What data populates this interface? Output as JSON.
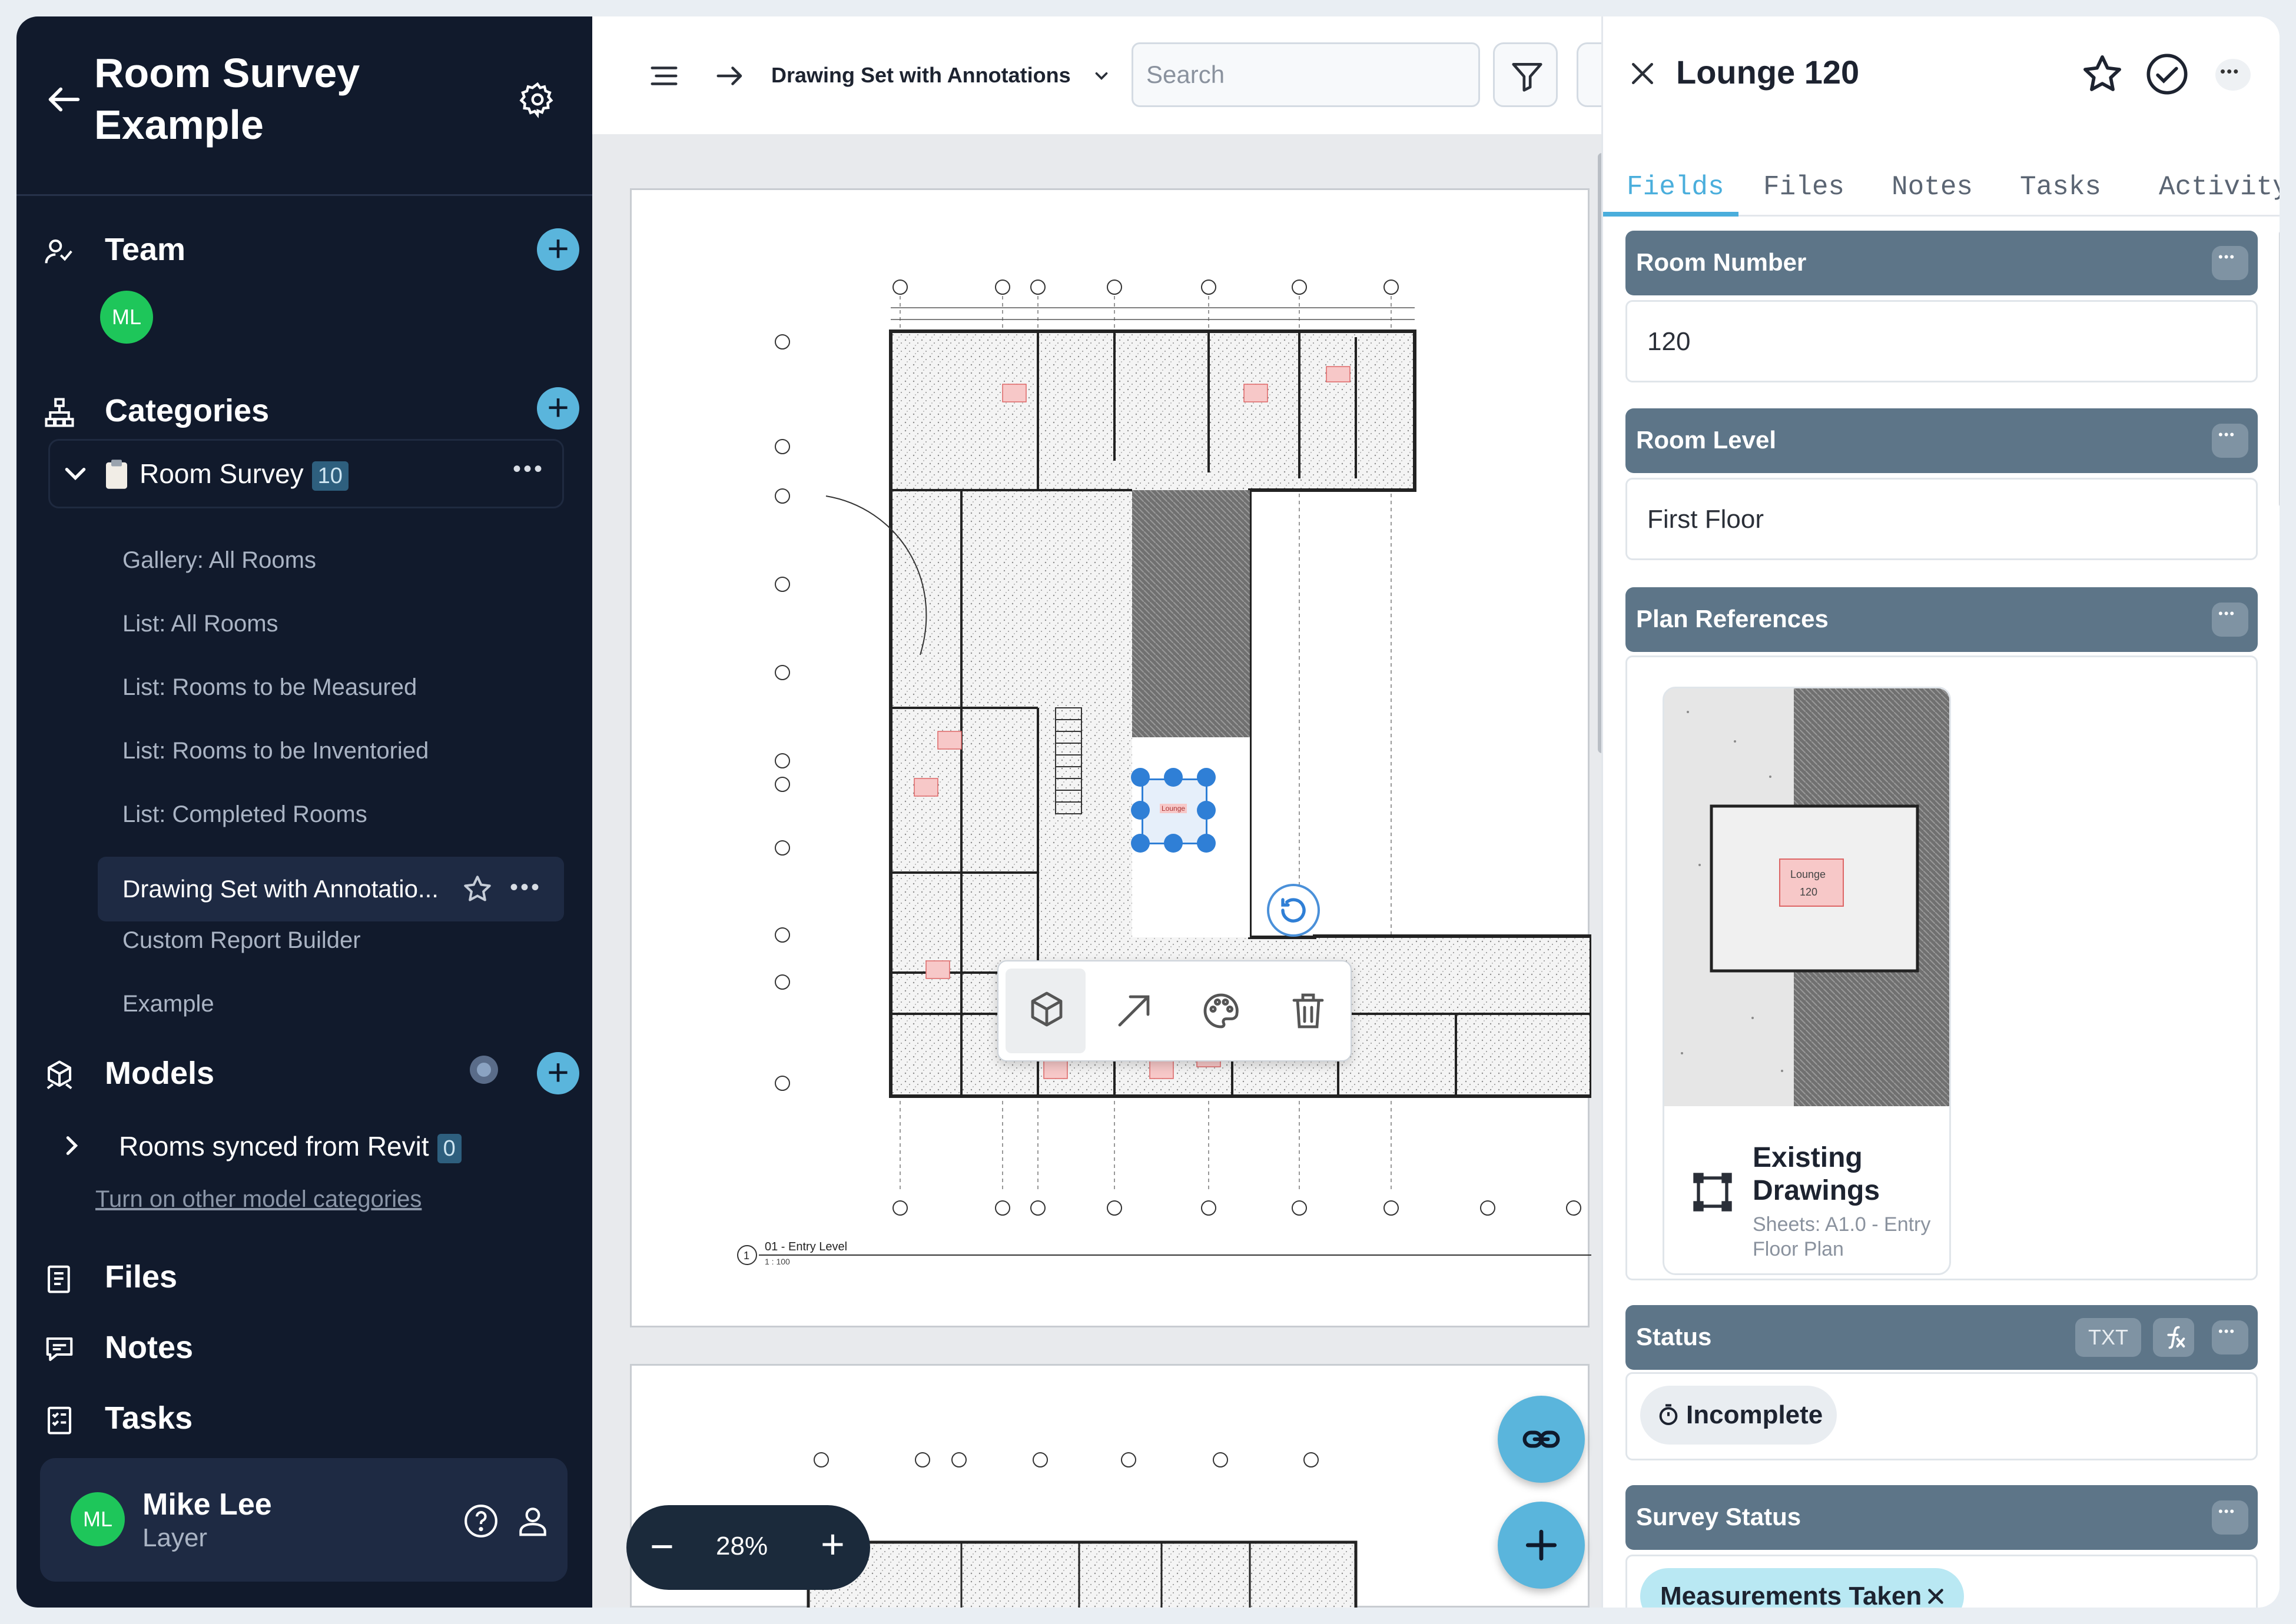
{
  "sidebar": {
    "back_label": "Back",
    "title": "Room Survey Example",
    "team": {
      "label": "Team",
      "avatar_initials": "ML"
    },
    "categories": {
      "label": "Categories",
      "room_survey": {
        "name": "Room Survey",
        "count": "10"
      },
      "views": [
        "Gallery: All Rooms",
        "List: All Rooms",
        "List: Rooms to be Measured",
        "List: Rooms to be Inventoried",
        "List: Completed Rooms",
        "Drawing Set with Annotatio...",
        "Custom Report Builder",
        "Example"
      ],
      "selected_index": 5
    },
    "models": {
      "label": "Models",
      "item": {
        "name": "Rooms synced from Revit",
        "count": "0"
      },
      "link": "Turn on other model categories"
    },
    "files_label": "Files",
    "notes_label": "Notes",
    "tasks_label": "Tasks",
    "user": {
      "initials": "ML",
      "name": "Mike Lee",
      "sub": "Layer"
    }
  },
  "toolbar": {
    "document": "Drawing Set with Annotations",
    "search_placeholder": "Search"
  },
  "canvas": {
    "zoom": "28%",
    "sheet_caption": "01 - Entry Level",
    "sheet_scale": "1 : 100",
    "room_tag": "Lounge"
  },
  "detail": {
    "title": "Lounge 120",
    "tabs": [
      "Fields",
      "Files",
      "Notes",
      "Tasks",
      "Activity"
    ],
    "active_tab": 0,
    "fields": {
      "room_number": {
        "label": "Room Number",
        "value": "120"
      },
      "room_level": {
        "label": "Room Level",
        "value": "First Floor"
      },
      "plan_references": {
        "label": "Plan References",
        "card_title": "Existing Drawings",
        "card_subtitle": "Sheets: A1.0 - Entry Floor Plan",
        "thumb_label": "Lounge",
        "thumb_number": "120"
      },
      "status": {
        "label": "Status",
        "txt_badge": "TXT",
        "value": "Incomplete"
      },
      "survey_status": {
        "label": "Survey Status",
        "value": "Measurements Taken"
      }
    }
  },
  "colors": {
    "sidebar_bg": "#111a2c",
    "accent": "#5ab5dc",
    "field_header": "#5d7588",
    "tab_active": "#4aaedc",
    "selection": "#2f7fd6"
  },
  "icons": [
    "arrow-left-icon",
    "gear-icon",
    "team-icon",
    "categories-icon",
    "clipboard-icon",
    "models-icon",
    "files-icon",
    "notes-icon",
    "tasks-icon",
    "help-icon",
    "user-icon",
    "menu-icon",
    "arrow-right-icon",
    "filter-icon",
    "close-icon",
    "star-icon",
    "check-circle-icon",
    "more-icon",
    "link-icon",
    "plus-icon",
    "cube-icon",
    "arrow-icon",
    "palette-icon",
    "trash-icon",
    "rotate-icon",
    "fx-icon",
    "rectangle-icon"
  ]
}
